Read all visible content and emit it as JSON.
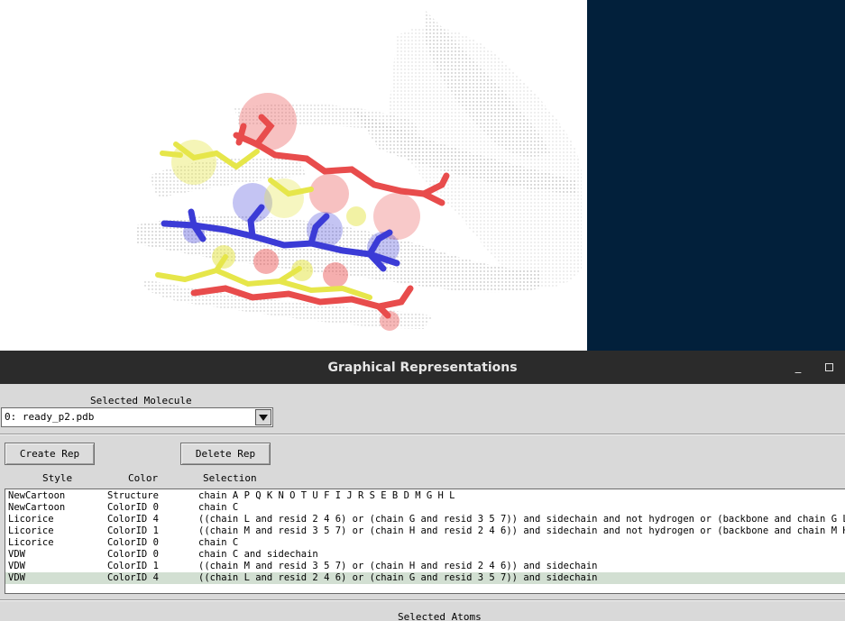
{
  "window": {
    "title": "Graphical Representations",
    "minimize_glyph": "_",
    "controls": [
      "minimize-icon",
      "maximize-icon"
    ]
  },
  "colors": {
    "viewport_background": "#ffffff",
    "display_background": "#02203b",
    "titlebar": "#2b2b2b",
    "panel": "#d9d9d9",
    "selected_row": "#d2dfd2",
    "red_rep": "#e84c4c",
    "blue_rep": "#3b3bd6",
    "yellow_rep": "#e6e64a"
  },
  "molecule": {
    "label": "Selected Molecule",
    "value": "0: ready_p2.pdb"
  },
  "buttons": {
    "create": "Create Rep",
    "delete": "Delete Rep"
  },
  "columns": {
    "style": "Style",
    "color": "Color",
    "selection": "Selection"
  },
  "reps": [
    {
      "style": "NewCartoon",
      "color": "Structure",
      "selection": "chain A P Q K N O T U F I J R S E B D M G H L",
      "selected": false
    },
    {
      "style": "NewCartoon",
      "color": "ColorID 0",
      "selection": "chain C",
      "selected": false
    },
    {
      "style": "Licorice",
      "color": "ColorID 4",
      "selection": "((chain L and resid 2 4 6) or (chain G and resid 3 5 7)) and sidechain and not hydrogen or (backbone and chain G L)",
      "selected": false
    },
    {
      "style": "Licorice",
      "color": "ColorID 1",
      "selection": "((chain M and resid 3 5 7) or (chain H and resid 2 4 6)) and sidechain and not hydrogen or (backbone and chain M H)",
      "selected": false
    },
    {
      "style": "Licorice",
      "color": "ColorID 0",
      "selection": "chain C",
      "selected": false
    },
    {
      "style": "VDW",
      "color": "ColorID 0",
      "selection": "chain C and sidechain",
      "selected": false
    },
    {
      "style": "VDW",
      "color": "ColorID 1",
      "selection": "((chain M and resid 3 5 7) or (chain H and resid 2 4 6)) and sidechain",
      "selected": false
    },
    {
      "style": "VDW",
      "color": "ColorID 4",
      "selection": "((chain L and resid 2 4 6) or (chain G and resid 3 5 7)) and sidechain",
      "selected": true
    }
  ],
  "selected_atoms_label": "Selected Atoms"
}
